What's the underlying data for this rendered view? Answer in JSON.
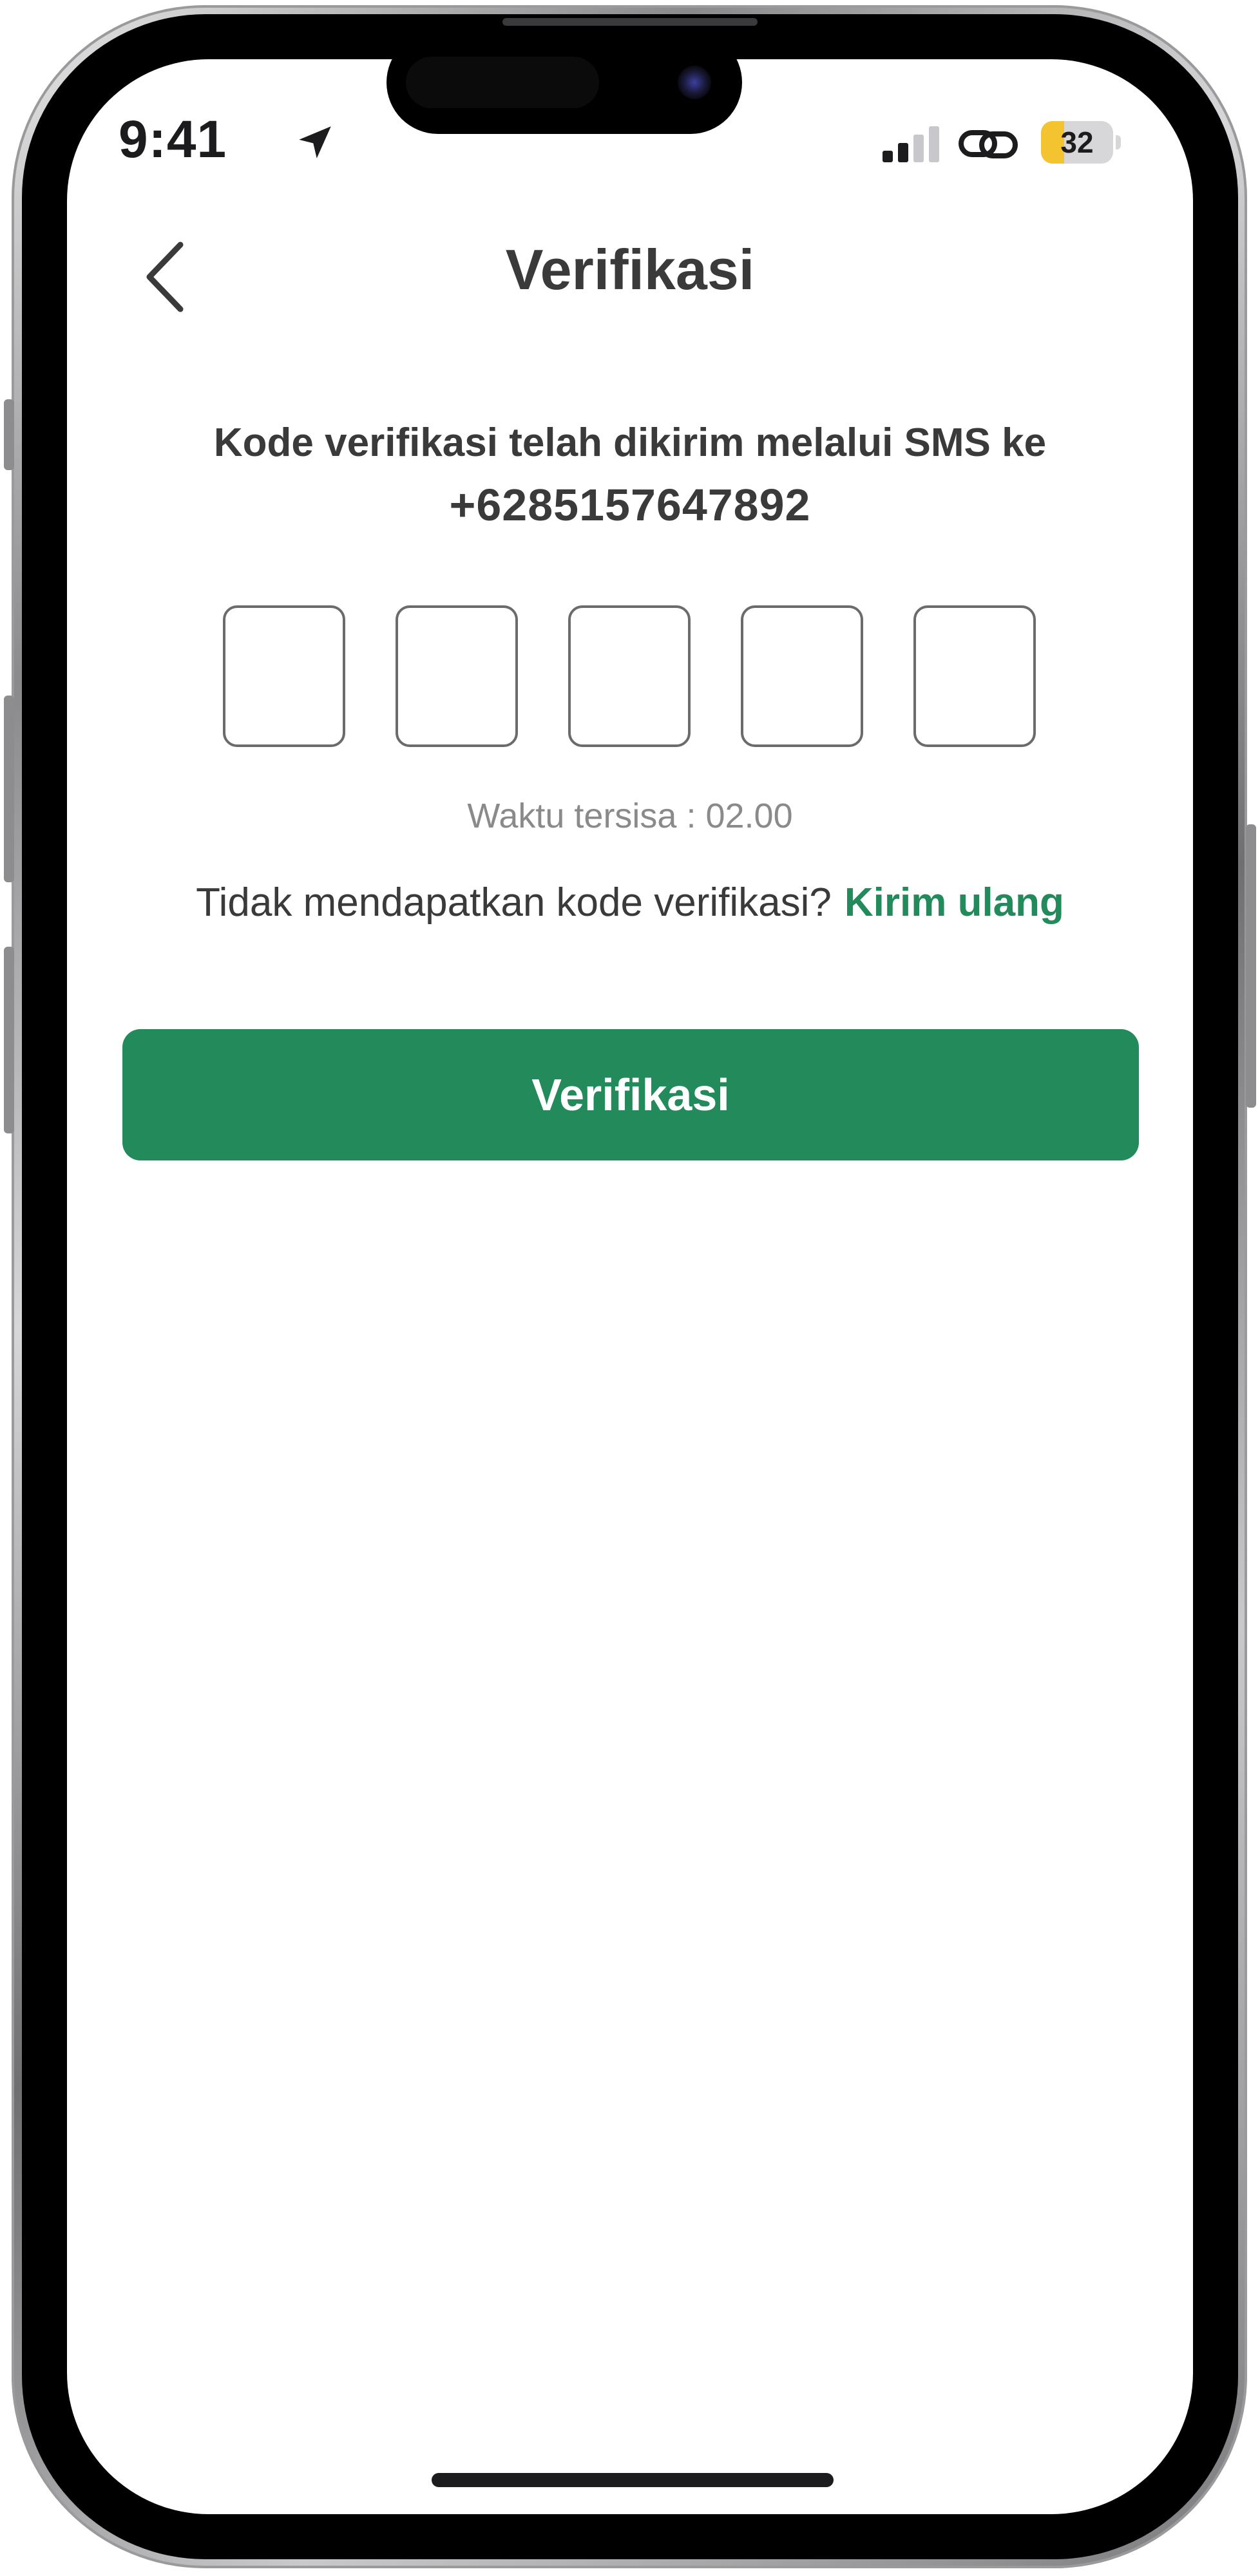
{
  "status_bar": {
    "time": "9:41",
    "battery_level": "32",
    "battery_fraction": 0.32,
    "signal_bars_active": 2,
    "signal_bars_total": 4,
    "icons": [
      "location-arrow-icon",
      "signal-icon",
      "link-icon",
      "battery-icon"
    ]
  },
  "header": {
    "title": "Verifikasi",
    "back_icon": "chevron-left-icon"
  },
  "verification": {
    "message": "Kode verifikasi telah dikirim melalui SMS ke",
    "phone_number": "+6285157647892",
    "code_digits": [
      "",
      "",
      "",
      "",
      ""
    ],
    "timer_text": "Waktu tersisa : 02.00",
    "resend_prompt": "Tidak mendapatkan kode verifikasi?",
    "resend_link": "Kirim ulang",
    "submit_label": "Verifikasi"
  },
  "colors": {
    "primary": "#238a5b",
    "text": "#3a3a3a",
    "muted": "#8a8a8a",
    "battery": "#f4c430"
  }
}
